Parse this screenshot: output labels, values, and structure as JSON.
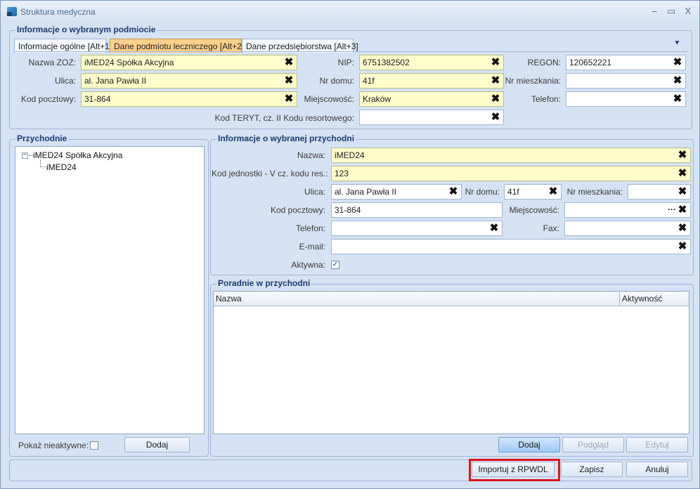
{
  "window": {
    "title": "Struktura medyczna",
    "controls": {
      "minimize": "–",
      "maximize": "▭",
      "close": "X"
    }
  },
  "entity_group": {
    "title": "Informacje o wybranym podmiocie",
    "tabs": [
      {
        "label": "Informacje ogólne [Alt+1]"
      },
      {
        "label": "Dane podmiotu leczniczego [Alt+2]"
      },
      {
        "label": "Dane przedsiębiorstwa [Alt+3]"
      }
    ],
    "collapse_glyph": "⯆",
    "fields": {
      "nazwa_zoz": {
        "label": "Nazwa ZOZ:",
        "value": "iMED24 Spółka Akcyjna"
      },
      "nip": {
        "label": "NIP:",
        "value": "6751382502"
      },
      "regon": {
        "label": "REGON:",
        "value": "120652221"
      },
      "ulica": {
        "label": "Ulica:",
        "value": "al. Jana Pawła II"
      },
      "nr_domu": {
        "label": "Nr domu:",
        "value": "41f"
      },
      "nr_mieszkania": {
        "label": "Nr mieszkania:",
        "value": ""
      },
      "kod_pocztowy": {
        "label": "Kod pocztowy:",
        "value": "31-864"
      },
      "miejscowosc": {
        "label": "Miejscowość:",
        "value": "Kraków"
      },
      "telefon": {
        "label": "Telefon:",
        "value": ""
      },
      "kod_teryt": {
        "label": "Kod TERYT, cz. II Kodu resortowego:",
        "value": ""
      }
    }
  },
  "clinics_group": {
    "title": "Przychodnie",
    "tree": {
      "root": "iMED24 Spółka Akcyjna",
      "child": "iMED24",
      "expander": "−"
    },
    "show_inactive_label": "Pokaż nieaktywne:",
    "add_label": "Dodaj"
  },
  "clinic_info_group": {
    "title": "Informacje o wybranej przychodni",
    "fields": {
      "nazwa": {
        "label": "Nazwa:",
        "value": "iMED24"
      },
      "kod_jednostki": {
        "label": "Kod jednostki - V cz. kodu res.:",
        "value": "123"
      },
      "ulica": {
        "label": "Ulica:",
        "value": "al. Jana Pawła II"
      },
      "nr_domu": {
        "label": "Nr domu:",
        "value": "41f"
      },
      "nr_mieszkania": {
        "label": "Nr mieszkania:",
        "value": ""
      },
      "kod_pocztowy": {
        "label": "Kod pocztowy:",
        "value": "31-864"
      },
      "miejscowosc": {
        "label": "Miejscowość:",
        "value": ""
      },
      "telefon": {
        "label": "Telefon:",
        "value": ""
      },
      "fax": {
        "label": "Fax:",
        "value": ""
      },
      "email": {
        "label": "E-mail:",
        "value": ""
      },
      "aktywna": {
        "label": "Aktywna:",
        "checked": "✓"
      }
    }
  },
  "outpatient_group": {
    "title": "Poradnie w przychodni",
    "columns": [
      "Nazwa",
      "Aktywność"
    ],
    "buttons": {
      "add": "Dodaj",
      "preview": "Podgląd",
      "edit": "Edytuj"
    }
  },
  "footer": {
    "import": "Importuj z RPWDL",
    "save": "Zapisz",
    "cancel": "Anuluj"
  },
  "icons": {
    "clear": "✖",
    "ellipsis": "···"
  },
  "colors": {
    "highlight": "#e0141e",
    "required_field": "#fdfcca",
    "active_tab": "#ffd08c"
  }
}
